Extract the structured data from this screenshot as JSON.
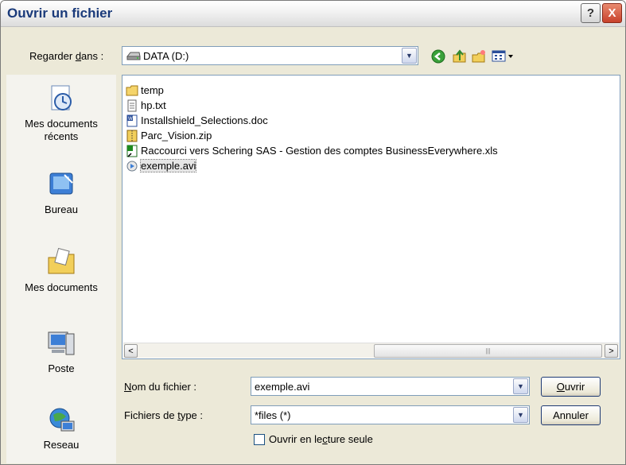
{
  "window": {
    "title": "Ouvrir un fichier",
    "help_label": "?",
    "close_label": "X"
  },
  "lookin": {
    "label_pre": "Regarder ",
    "label_u": "d",
    "label_post": "ans :",
    "value": "DATA (D:)"
  },
  "toolbar": {
    "back_icon": "back-arrow-icon",
    "up_icon": "up-folder-icon",
    "newfolder_icon": "new-folder-icon",
    "views_icon": "views-menu-icon"
  },
  "places": [
    {
      "label": "Mes documents récents",
      "icon": "recent-documents-icon"
    },
    {
      "label": "Bureau",
      "icon": "desktop-icon"
    },
    {
      "label": "Mes documents",
      "icon": "my-documents-icon"
    },
    {
      "label": "Poste",
      "icon": "computer-icon"
    },
    {
      "label": "Reseau",
      "icon": "network-icon"
    }
  ],
  "files": [
    {
      "name": "temp",
      "icon": "folder-icon",
      "selected": false
    },
    {
      "name": "hp.txt",
      "icon": "text-file-icon",
      "selected": false
    },
    {
      "name": "Installshield_Selections.doc",
      "icon": "word-document-icon",
      "selected": false
    },
    {
      "name": "Parc_Vision.zip",
      "icon": "zip-file-icon",
      "selected": false
    },
    {
      "name": "Raccourci vers Schering SAS - Gestion des comptes BusinessEverywhere.xls",
      "icon": "excel-shortcut-icon",
      "selected": false
    },
    {
      "name": "exemple.avi",
      "icon": "media-file-icon",
      "selected": true
    }
  ],
  "scrollbar": {
    "left": "<",
    "right": ">",
    "grip": "|||"
  },
  "filename": {
    "label_u": "N",
    "label_post": "om du fichier :",
    "value": "exemple.avi"
  },
  "filetype": {
    "label_pre": "Fichiers de ",
    "label_u": "t",
    "label_post": "ype :",
    "value": "*files (*)"
  },
  "buttons": {
    "open_u": "O",
    "open_post": "uvrir",
    "cancel": "Annuler"
  },
  "readonly": {
    "label_pre": "Ouvrir en le",
    "label_u": "c",
    "label_post": "ture seule"
  },
  "colors": {
    "selection": "#e6e6e6",
    "border": "#7f9db9",
    "dialog_bg": "#ece9d8"
  }
}
